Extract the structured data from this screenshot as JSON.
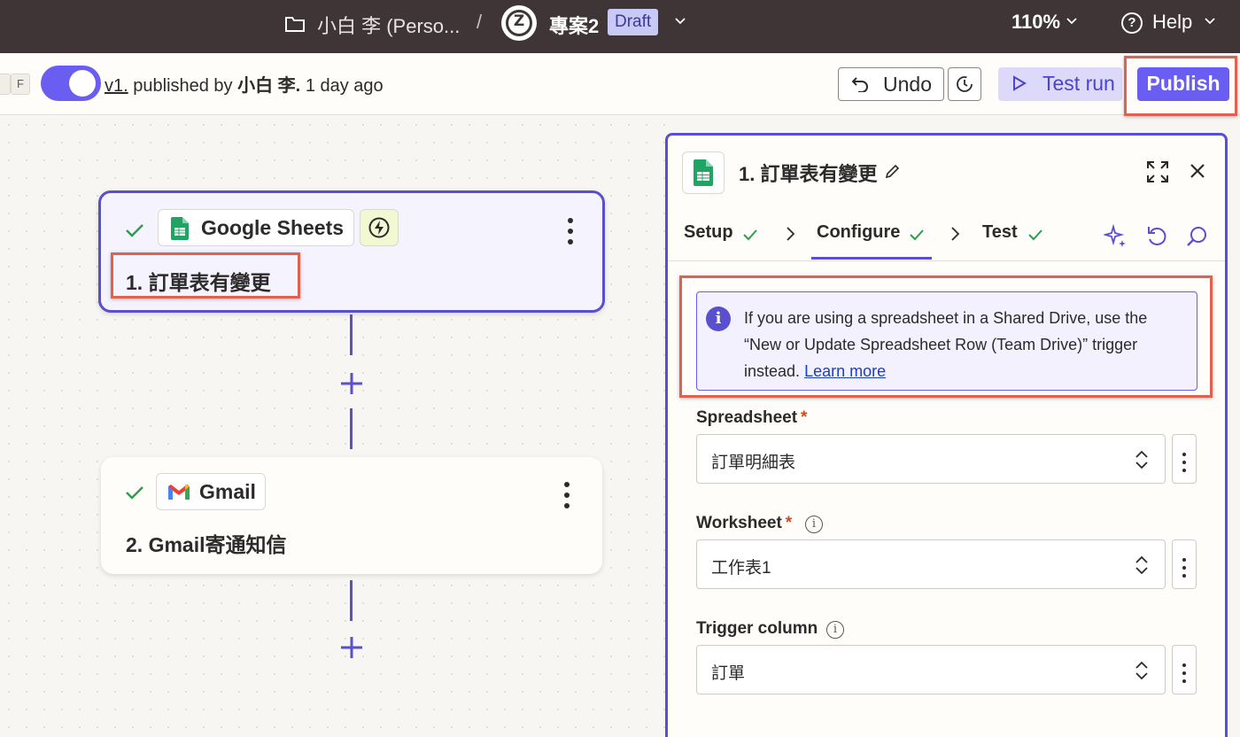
{
  "topbar": {
    "breadcrumb_folder": "小白 李 (Perso...",
    "separator": "/",
    "logo_letter": "Z",
    "project_name": "專案2",
    "draft_badge": "Draft",
    "zoom": "110%",
    "help_label": "Help",
    "help_icon_glyph": "?"
  },
  "toolbar": {
    "kbd_keys": [
      "F"
    ],
    "version_link": "v1.",
    "published_by": "published by",
    "author": "小白 李.",
    "time_ago": "1 day ago",
    "undo_label": "Undo",
    "test_run_label": "Test run",
    "publish_label": "Publish",
    "toggle_on": true
  },
  "canvas": {
    "steps": [
      {
        "app": "Google Sheets",
        "title": "1. 訂單表有變更",
        "status": "complete",
        "icon": "google-sheets-icon"
      },
      {
        "app": "Gmail",
        "title": "2. Gmail寄通知信",
        "status": "complete",
        "icon": "gmail-icon"
      }
    ]
  },
  "panel": {
    "title": "1. 訂單表有變更",
    "tabs": [
      {
        "label": "Setup",
        "complete": true
      },
      {
        "label": "Configure",
        "complete": true,
        "active": true
      },
      {
        "label": "Test",
        "complete": true
      }
    ],
    "info": {
      "icon_glyph": "i",
      "text": "If you are using a spreadsheet in a Shared Drive, use the “New or Update Spreadsheet Row (Team Drive)” trigger instead.",
      "link": "Learn more"
    },
    "fields": [
      {
        "label": "Spreadsheet",
        "required": true,
        "has_info": false,
        "value": "訂單明細表"
      },
      {
        "label": "Worksheet",
        "required": true,
        "has_info": true,
        "value": "工作表1"
      },
      {
        "label": "Trigger column",
        "required": false,
        "has_info": true,
        "value": "訂單"
      }
    ],
    "required_marker": "*",
    "field_info_glyph": "i"
  },
  "colors": {
    "accent": "#6a5df1",
    "topbar": "#403536",
    "highlight": "#e2604e",
    "success": "#2e9d4f"
  }
}
